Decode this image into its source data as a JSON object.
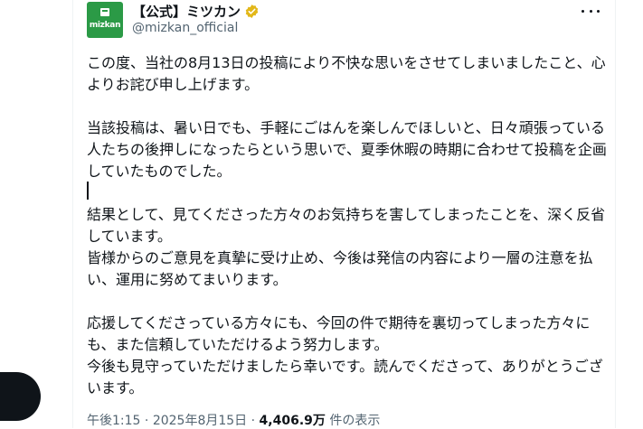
{
  "account": {
    "display_name": "【公式】ミツカン",
    "handle": "@mizkan_official",
    "avatar_text": "mizkan",
    "verified_color": "#e2b719"
  },
  "tweet": {
    "paragraphs": [
      "この度、当社の8月13日の投稿により不快な思いをさせてしまいましたこと、心よりお詫び申し上げます。",
      "",
      "当該投稿は、暑い日でも、手軽にごはんを楽しんでほしいと、日々頑張っている人たちの後押しになったらという思いで、夏季休暇の時期に合わせて投稿を企画していたものでした。",
      "",
      "結果として、見てくださった方々のお気持ちを害してしまったことを、深く反省しています。",
      "皆様からのご意見を真摯に受け止め、今後は発信の内容により一層の注意を払い、運用に努めてまいります。",
      "",
      "応援してくださっている方々にも、今回の件で期待を裏切ってしまった方々にも、また信頼していただけるよう努力します。",
      "今後も見守っていただけましたら幸いです。読んでくださって、ありがとうございます。"
    ]
  },
  "meta": {
    "time": "午後1:15",
    "separator": " · ",
    "date": "2025年8月15日",
    "views_count": "4,406.9万",
    "views_label": " 件の表示"
  },
  "icons": {
    "more": "more-horizontal-icon",
    "verified": "verified-badge-icon"
  }
}
